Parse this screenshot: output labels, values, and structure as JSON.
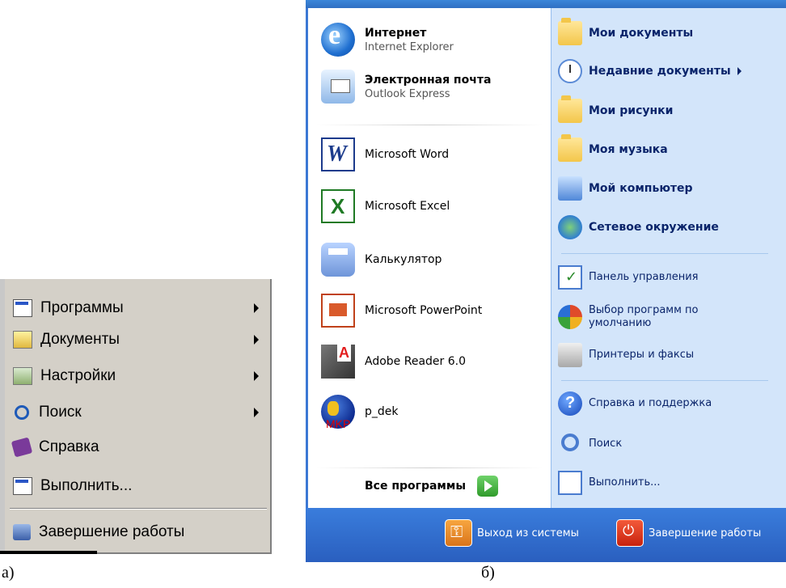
{
  "classic_menu": {
    "items": [
      {
        "label": "Программы",
        "icon": "programs-icon",
        "submenu": true
      },
      {
        "label": "Документы",
        "icon": "documents-icon",
        "submenu": true
      },
      {
        "label": "Настройки",
        "icon": "settings-icon",
        "submenu": true
      },
      {
        "label": "Поиск",
        "icon": "search-icon",
        "submenu": true
      },
      {
        "label": "Справка",
        "icon": "help-book-icon",
        "submenu": false
      },
      {
        "label": "Выполнить...",
        "icon": "run-icon",
        "submenu": false
      }
    ],
    "shutdown_label": "Завершение работы",
    "caption": "а)"
  },
  "xp_menu": {
    "pinned": [
      {
        "title": "Интернет",
        "subtitle": "Internet Explorer",
        "icon": "internet-explorer-icon"
      },
      {
        "title": "Электронная почта",
        "subtitle": "Outlook Express",
        "icon": "outlook-express-icon"
      }
    ],
    "recent": [
      {
        "title": "Microsoft Word",
        "icon": "word-icon"
      },
      {
        "title": "Microsoft Excel",
        "icon": "excel-icon"
      },
      {
        "title": "Калькулятор",
        "icon": "calculator-icon"
      },
      {
        "title": "Microsoft PowerPoint",
        "icon": "powerpoint-icon"
      },
      {
        "title": "Adobe Reader 6.0",
        "icon": "adobe-reader-icon"
      },
      {
        "title": "p_dek",
        "icon": "globe-icon",
        "badge": "MKP"
      }
    ],
    "all_programs": "Все программы",
    "places": [
      {
        "label": "Мои документы",
        "icon": "my-documents-icon"
      },
      {
        "label": "Недавние документы",
        "icon": "recent-documents-icon",
        "submenu": true
      },
      {
        "label": "Мои рисунки",
        "icon": "my-pictures-icon"
      },
      {
        "label": "Моя музыка",
        "icon": "my-music-icon"
      },
      {
        "label": "Мой компьютер",
        "icon": "my-computer-icon"
      },
      {
        "label": "Сетевое окружение",
        "icon": "network-icon"
      }
    ],
    "settings": [
      {
        "label": "Панель управления",
        "icon": "control-panel-icon"
      },
      {
        "label": "Выбор программ по умолчанию",
        "icon": "default-programs-icon"
      },
      {
        "label": "Принтеры и факсы",
        "icon": "printers-icon"
      }
    ],
    "tools": [
      {
        "label": "Справка и поддержка",
        "icon": "help-support-icon"
      },
      {
        "label": "Поиск",
        "icon": "search-icon"
      },
      {
        "label": "Выполнить...",
        "icon": "run-icon"
      }
    ],
    "logoff_label": "Выход из системы",
    "shutdown_label": "Завершение работы",
    "caption": "б)"
  },
  "colors": {
    "classic_bg": "#d4d0c8",
    "xp_blue": "#2f6fc3",
    "xp_right_panel": "#d3e5fa"
  }
}
